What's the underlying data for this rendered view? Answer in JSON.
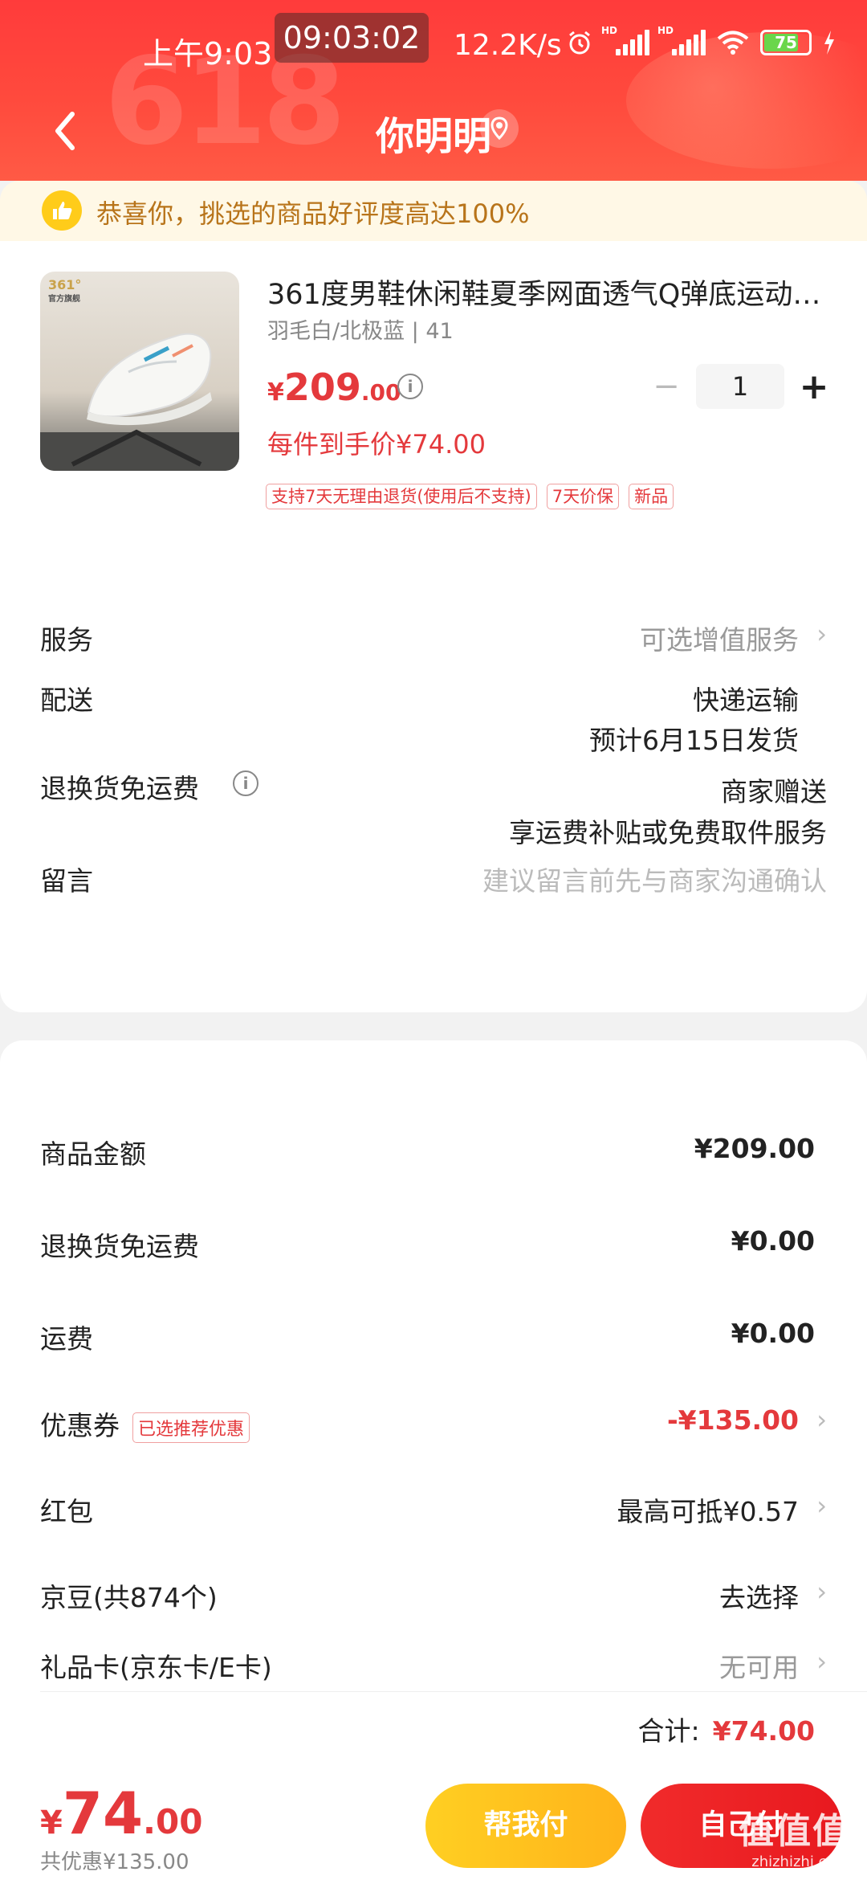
{
  "status_bar": {
    "time_left": "上午9:03",
    "clock": "09:03:02",
    "net_speed": "12.2K/s",
    "battery": "75"
  },
  "header": {
    "title": "你明明",
    "decoration": "618"
  },
  "notice": {
    "text": "恭喜你，挑选的商品好评度高达100%"
  },
  "product": {
    "brand": "361°",
    "brand_sub": "官方旗舰",
    "name": "361度男鞋休闲鞋夏季网面透气Q弹底运动…",
    "spec": "羽毛白/北极蓝 | 41",
    "price_symbol": "¥",
    "price_int": "209",
    "price_dec": ".00",
    "qty": "1",
    "unit_price": "每件到手价¥74.00",
    "tags": [
      "支持7天无理由退货(使用后不支持)",
      "7天价保",
      "新品"
    ]
  },
  "order_rows": {
    "service": {
      "label": "服务",
      "value": "可选增值服务"
    },
    "delivery": {
      "label": "配送",
      "value1": "快递运输",
      "value2": "预计6月15日发货"
    },
    "return_fee": {
      "label": "退换货免运费",
      "value1": "商家赠送",
      "value2": "享运费补贴或免费取件服务"
    },
    "message": {
      "label": "留言",
      "placeholder": "建议留言前先与商家沟通确认"
    }
  },
  "summary": {
    "goods_amount": {
      "label": "商品金额",
      "value": "¥209.00"
    },
    "return_free": {
      "label": "退换货免运费",
      "value": "¥0.00"
    },
    "shipping": {
      "label": "运费",
      "value": "¥0.00"
    },
    "coupon": {
      "label": "优惠券",
      "badge": "已选推荐优惠",
      "value": "-¥135.00"
    },
    "red_packet": {
      "label": "红包",
      "value": "最高可抵¥0.57"
    },
    "jingdou": {
      "label": "京豆(共874个)",
      "value": "去选择"
    },
    "gift_card": {
      "label": "礼品卡(京东卡/E卡)",
      "value": "无可用"
    },
    "total_label": "合计:",
    "total_value": "¥74.00"
  },
  "bottom_bar": {
    "price_symbol": "¥",
    "price_int": "74",
    "price_dec": ".00",
    "saved": "共优惠¥135.00",
    "help_pay": "帮我付",
    "self_pay": "自己付"
  },
  "watermark": {
    "logo": "值值值",
    "url": "zhizhizhi.com"
  },
  "colors": {
    "accent_red": "#e4393c",
    "header_red": "#ff3b3b",
    "help_yellow": "#ffcf22",
    "notice_bg": "#fff8e6"
  }
}
